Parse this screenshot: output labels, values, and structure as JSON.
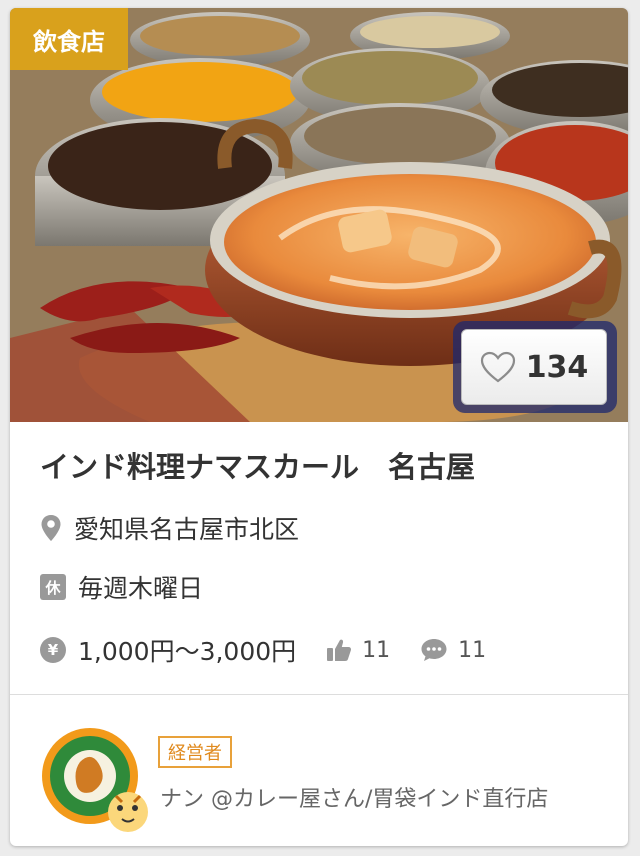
{
  "card": {
    "category_badge": "飲食店",
    "like_count": "134",
    "title": "インド料理ナマスカール　名古屋",
    "address": "愛知県名古屋市北区",
    "holiday_icon_label": "休",
    "holiday": "毎週木曜日",
    "yen_icon_label": "¥",
    "price": "1,000円〜3,000円",
    "likes": "11",
    "comments": "11",
    "role_badge": "経営者",
    "author": "ナン @カレー屋さん/胃袋インド直行店"
  },
  "colors": {
    "badge_bg": "#d9a11c",
    "role_border": "#e8a13a",
    "icon_gray": "#999999",
    "text": "#333333"
  },
  "icons": [
    "map-pin-icon",
    "heart-icon",
    "thumbs-up-icon",
    "comment-icon"
  ]
}
